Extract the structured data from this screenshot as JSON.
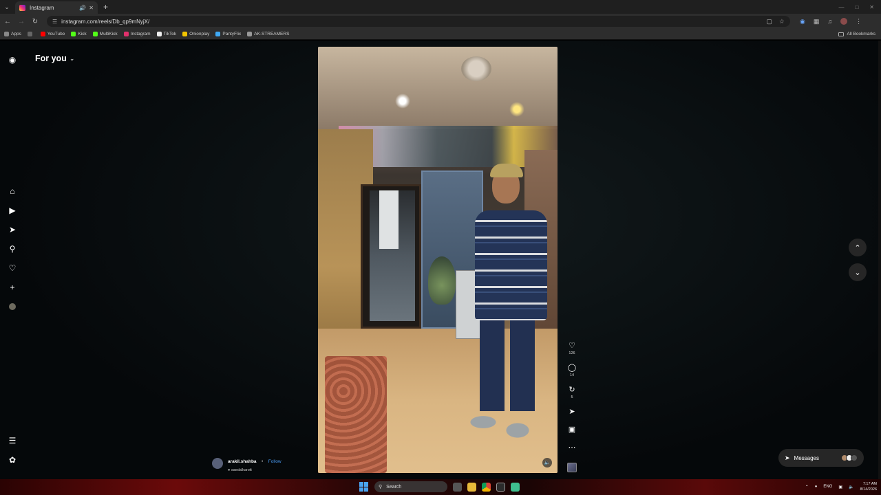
{
  "browser": {
    "tab_title": "Instagram",
    "url": "instagram.com/reels/Db_qp9mNyjX/",
    "bookmarks": [
      {
        "label": "Apps",
        "color": "#888888"
      },
      {
        "label": "YouTube",
        "color": "#ff0000"
      },
      {
        "label": "Kick",
        "color": "#53fc18"
      },
      {
        "label": "MultiKick",
        "color": "#53fc18"
      },
      {
        "label": "Instagram",
        "color": "#e1306c"
      },
      {
        "label": "TikTok",
        "color": "#eeeeee"
      },
      {
        "label": "Onionplay",
        "color": "#f2c500"
      },
      {
        "label": "PantyFlix",
        "color": "#3fa9f5"
      },
      {
        "label": "AK-STREAMERS",
        "color": "#999999"
      }
    ],
    "all_bookmarks": "All Bookmarks"
  },
  "header": {
    "feed_label": "For you"
  },
  "reel": {
    "author": "arakil.shahba",
    "follow": "Follow",
    "separator": "•",
    "audio": "saedalkarott",
    "likes": "126",
    "comments": "14",
    "reposts": "5"
  },
  "messages": {
    "label": "Messages"
  },
  "taskbar": {
    "search_placeholder": "Search",
    "lang": "ENG",
    "time": "7:17 AM",
    "date": "8/14/2026"
  },
  "colors": {
    "accent_follow": "#4c9ff8",
    "page_bg": "#05080a",
    "chrome_bg": "#2d2d2d"
  }
}
